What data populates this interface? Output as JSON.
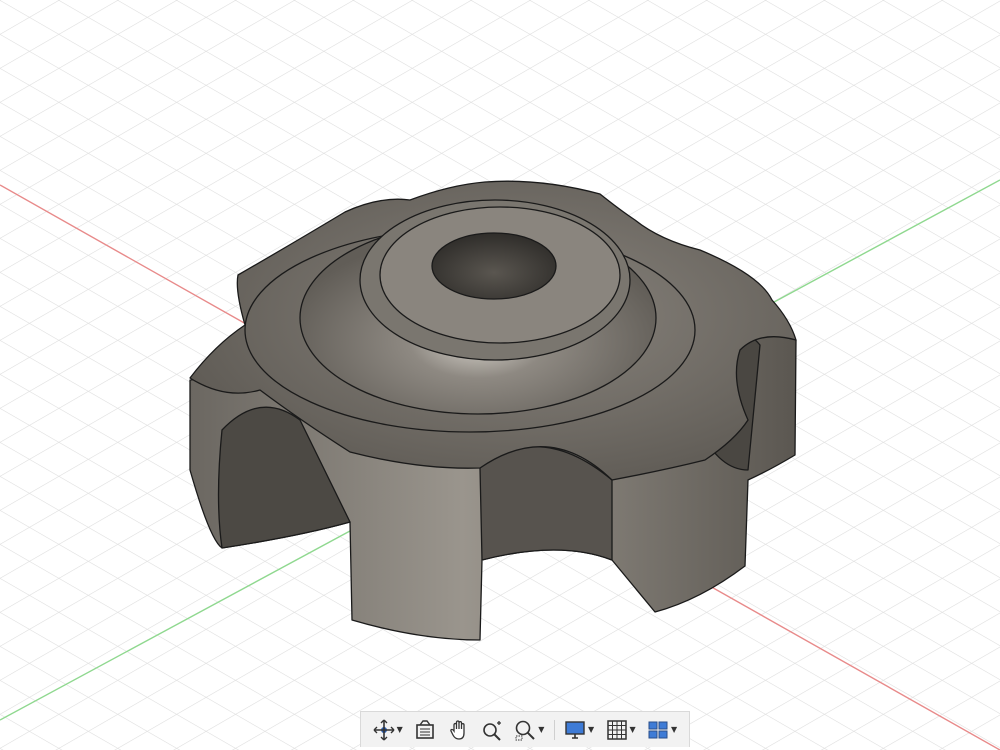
{
  "app": {
    "name": "CAD viewport"
  },
  "viewport": {
    "background": "#ffffff",
    "grid_color": "#dcdcdc",
    "x_axis_color": "#e88a8a",
    "y_axis_color": "#8fd88f",
    "model": {
      "description_name": "knob",
      "body_color": "#6e6a64",
      "edge_color": "#1a1a1a"
    }
  },
  "toolbar": {
    "buttons": [
      {
        "name": "orbit-button",
        "icon": "orbit-icon",
        "has_menu": true
      },
      {
        "name": "look-at-button",
        "icon": "look-at-icon",
        "has_menu": false
      },
      {
        "name": "pan-button",
        "icon": "hand-icon",
        "has_menu": false
      },
      {
        "name": "zoom-button",
        "icon": "zoom-plus-icon",
        "has_menu": false
      },
      {
        "name": "fit-button",
        "icon": "zoom-window-icon",
        "has_menu": true
      },
      {
        "name": "display-settings-button",
        "icon": "monitor-icon",
        "has_menu": true
      },
      {
        "name": "grid-settings-button",
        "icon": "grid-icon",
        "has_menu": true
      },
      {
        "name": "viewports-button",
        "icon": "viewports-icon",
        "has_menu": true
      }
    ]
  }
}
